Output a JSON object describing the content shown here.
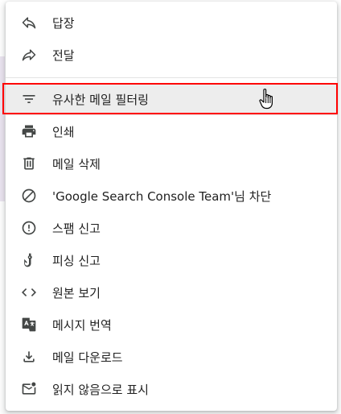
{
  "menu": {
    "items": [
      {
        "id": "reply",
        "label": "답장",
        "icon": "reply-icon"
      },
      {
        "id": "forward",
        "label": "전달",
        "icon": "forward-icon"
      },
      {
        "id": "filter",
        "label": "유사한 메일 필터링",
        "icon": "filter-icon",
        "highlighted": true
      },
      {
        "id": "print",
        "label": "인쇄",
        "icon": "print-icon"
      },
      {
        "id": "delete",
        "label": "메일 삭제",
        "icon": "trash-icon"
      },
      {
        "id": "block",
        "label": "'Google Search Console Team'님 차단",
        "icon": "block-icon"
      },
      {
        "id": "spam",
        "label": "스팸 신고",
        "icon": "report-spam-icon"
      },
      {
        "id": "phishing",
        "label": "피싱 신고",
        "icon": "phishing-hook-icon"
      },
      {
        "id": "original",
        "label": "원본 보기",
        "icon": "code-brackets-icon"
      },
      {
        "id": "translate",
        "label": "메시지 번역",
        "icon": "translate-icon"
      },
      {
        "id": "download",
        "label": "메일 다운로드",
        "icon": "download-icon"
      },
      {
        "id": "unread",
        "label": "읽지 않음으로 표시",
        "icon": "mark-unread-icon"
      }
    ]
  },
  "colors": {
    "icon": "#444746",
    "text": "#1f1f1f",
    "hover_bg": "#ededed",
    "annotation_border": "#ff0000"
  }
}
